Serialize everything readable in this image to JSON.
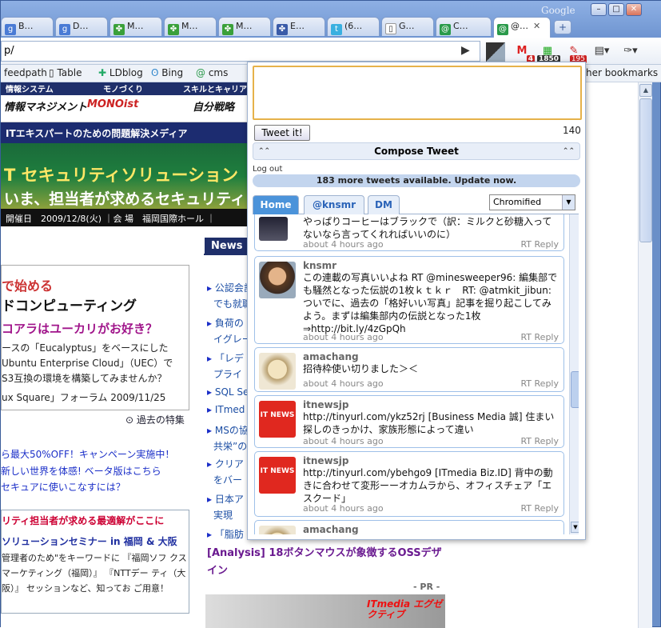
{
  "browser": {
    "brand": "Google",
    "tabs": [
      "B…",
      "D…",
      "M…",
      "M…",
      "M…",
      "E…",
      "(6…",
      "G…",
      "C…",
      "@…"
    ],
    "url": "p/",
    "extensions": {
      "gmail_count": "4",
      "grid_count": "1850",
      "tweet_count": "195"
    }
  },
  "bookmarks": {
    "items": [
      "feedpath",
      "Table",
      "LDblog",
      "Bing",
      "cms"
    ],
    "other": "her bookmarks"
  },
  "page": {
    "header_band_items": [
      "情報システム",
      "モノづくり",
      "スキルとキャリア"
    ],
    "logos": [
      "情報マネジメント",
      "MONOist",
      "自分戦略"
    ],
    "tagline": "ITエキスパートのための問題解決メディア",
    "banner": {
      "title": "T セキュリティソリューション",
      "subtitle": "いま、担当者が求めるセキュリティ",
      "info": "開催日　2009/12/8(火) ｜会 場　福岡国際ホール ｜"
    },
    "feature": {
      "line1": "で始める",
      "line2": "ドコンピューティング",
      "line3": "コアラはユーカリがお好き？",
      "body": "ースの「Eucalyptus」をベースにした Ubuntu Enterprise Cloud」（UEC）で S3互換の環境を構築してみませんか？",
      "footer": "ux Square」フォーラム 2009/11/25"
    },
    "more_features": "過去の特集",
    "promos": [
      "ら最大50%OFF！キャンペーン実施中！",
      "新しい世界を体感! ベータ版はこちら",
      "セキュアに使いこなすには？"
    ],
    "seminar": {
      "head": "リティ担当者が求める最適解がここに",
      "sub": "ソリューションセミナー in 福岡 & 大阪",
      "body": "管理者のため\"をキーワードに 『福岡ソフ クスマーケティング（福岡）』 『NTTデー ティ（大阪）』 セッションなど、知ってお ご用意！"
    },
    "news_label": "News",
    "news_items": [
      "公認会計",
      "でも就職",
      "負荷の",
      "イグレー",
      "「レデ",
      "プライ",
      "SQL Se",
      "ITmed",
      "MSの協",
      "共栄”の",
      "クリア",
      "をバー",
      "日本ア",
      "実現",
      "「脂肪"
    ],
    "analysis": "[Analysis] 18ボタンマウスが象徴するOSSデザイン",
    "pr": "- PR -",
    "exec_logo": "ITmedia エグゼクティブ"
  },
  "popup": {
    "tweet_button": "Tweet it!",
    "counter": "140",
    "compose_label": "Compose Tweet",
    "logout": "Log out",
    "update": "183 more tweets available. Update now.",
    "tabs": [
      "Home",
      "@knsmr",
      "DM"
    ],
    "selector": "Chromified",
    "tweets": [
      {
        "user": "",
        "text": "やっぱりコーヒーはブラックで（訳：ミルクと砂糖入ってないなら言ってくれればいいのに）",
        "time": "about 4 hours ago",
        "actions": "RT Reply"
      },
      {
        "user": "knsmr",
        "text": "この連載の写真いいよね RT @minesweeper96: 編集部でも騒然となった伝説の1枚ｋｔｋｒ　RT: @atmkit_jibun: ついでに、過去の「格好いい写真」記事を掘り起こしてみよう。まずは編集部内の伝説となった1枚　⇒http://bit.ly/4zGpQh",
        "time": "about 4 hours ago",
        "actions": "RT Reply"
      },
      {
        "user": "amachang",
        "text": "招待枠使い切りました＞＜",
        "time": "about 4 hours ago",
        "actions": "RT Reply"
      },
      {
        "user": "itnewsjp",
        "text": "http://tinyurl.com/ykz52rj [Business Media 誠] 住まい探しのきっかけ、家族形態によって違い",
        "time": "about 4 hours ago",
        "actions": "RT Reply"
      },
      {
        "user": "itnewsjp",
        "text": "http://tinyurl.com/ybehgo9 [ITmedia Biz.ID] 背中の動きに合わせて変形ーーオカムラから、オフィスチェア「エスクード」",
        "time": "about 4 hours ago",
        "actions": "RT Reply"
      },
      {
        "user": "amachang",
        "text": "",
        "time": "",
        "actions": ""
      }
    ],
    "avatar_label": "IT NEWS"
  },
  "colors": {
    "chrome_blue": "#6a8fc8",
    "accent_orange": "#e6b24a",
    "tab_blue": "#4b93da",
    "link": "#1a2ec8"
  }
}
